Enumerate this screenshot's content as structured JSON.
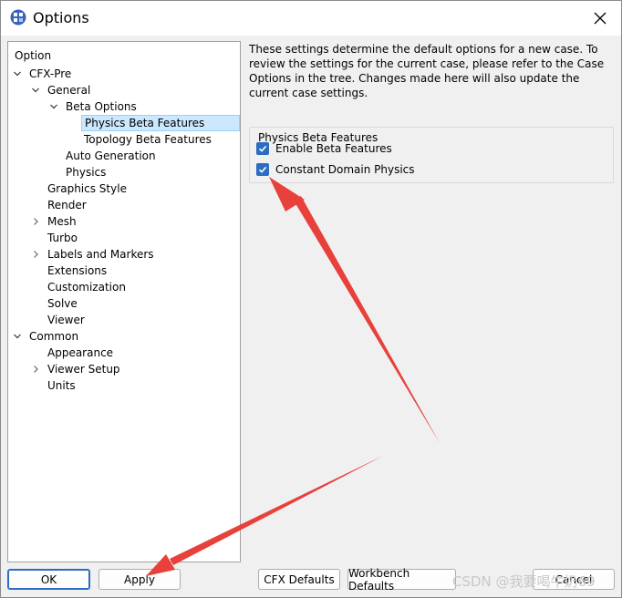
{
  "window": {
    "title": "Options",
    "close_label": "close"
  },
  "tree": {
    "root_label": "Option",
    "items": [
      {
        "label": "CFX-Pre",
        "depth": 0,
        "expander": "expanded"
      },
      {
        "label": "General",
        "depth": 1,
        "expander": "expanded"
      },
      {
        "label": "Beta Options",
        "depth": 2,
        "expander": "expanded"
      },
      {
        "label": "Physics Beta Features",
        "depth": 3,
        "expander": "none",
        "selected": true
      },
      {
        "label": "Topology Beta Features",
        "depth": 3,
        "expander": "none"
      },
      {
        "label": "Auto Generation",
        "depth": 2,
        "expander": "none"
      },
      {
        "label": "Physics",
        "depth": 2,
        "expander": "none"
      },
      {
        "label": "Graphics Style",
        "depth": 1,
        "expander": "none"
      },
      {
        "label": "Render",
        "depth": 1,
        "expander": "none"
      },
      {
        "label": "Mesh",
        "depth": 1,
        "expander": "collapsed"
      },
      {
        "label": "Turbo",
        "depth": 1,
        "expander": "none"
      },
      {
        "label": "Labels and Markers",
        "depth": 1,
        "expander": "collapsed"
      },
      {
        "label": "Extensions",
        "depth": 1,
        "expander": "none"
      },
      {
        "label": "Customization",
        "depth": 1,
        "expander": "none"
      },
      {
        "label": "Solve",
        "depth": 1,
        "expander": "none"
      },
      {
        "label": "Viewer",
        "depth": 1,
        "expander": "none"
      },
      {
        "label": "Common",
        "depth": 0,
        "expander": "expanded"
      },
      {
        "label": "Appearance",
        "depth": 1,
        "expander": "none"
      },
      {
        "label": "Viewer Setup",
        "depth": 1,
        "expander": "collapsed"
      },
      {
        "label": "Units",
        "depth": 1,
        "expander": "none"
      }
    ]
  },
  "content": {
    "description": "These settings determine the default options for a new case. To review the settings for the current case, please refer to the Case Options in the tree. Changes made here will also update the current case settings.",
    "group_title": "Physics Beta Features",
    "checkboxes": [
      {
        "label": "Enable Beta Features",
        "checked": true
      },
      {
        "label": "Constant Domain Physics",
        "checked": true
      }
    ]
  },
  "buttons": {
    "ok": "OK",
    "apply": "Apply",
    "cfx_defaults": "CFX Defaults",
    "workbench_defaults": "Workbench Defaults",
    "cancel": "Cancel"
  },
  "watermark": "CSDN @我要喝牛奶69",
  "colors": {
    "accent": "#2c6cc2",
    "selection": "#cce8ff",
    "annotation_arrow": "#e8403a"
  }
}
